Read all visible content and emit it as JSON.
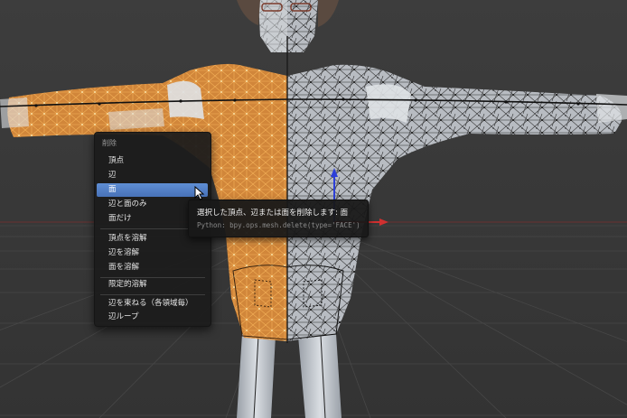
{
  "context_menu": {
    "title": "削除",
    "groups": [
      [
        "頂点",
        "辺",
        "面",
        "辺と面のみ",
        "面だけ"
      ],
      [
        "頂点を溶解",
        "辺を溶解",
        "面を溶解"
      ],
      [
        "限定的溶解"
      ],
      [
        "辺を束ねる（各領域毎）",
        "辺ループ"
      ]
    ],
    "items": {
      "vertices": "頂点",
      "edges": "辺",
      "faces": "面",
      "edges_and_faces": "辺と面のみ",
      "only_faces": "面だけ",
      "dissolve_vertices": "頂点を溶解",
      "dissolve_edges": "辺を溶解",
      "dissolve_faces": "面を溶解",
      "limited_dissolve": "限定的溶解",
      "edge_collapse": "辺を束ねる（各領域毎）",
      "edge_loops": "辺ループ"
    },
    "highlighted": "面"
  },
  "tooltip": {
    "title": "選択した頂点、辺または面を削除します: 面",
    "python": "Python: bpy.ops.mesh.delete(type='FACE')"
  },
  "viewport": {
    "background_color": "#3a3a3a",
    "grid_color": "#484848",
    "selected_mesh_color": "#e8962a",
    "unselected_mesh_color": "#c8c8c8",
    "x_axis_color": "#d03030",
    "z_axis_color": "#2c3fd8"
  }
}
